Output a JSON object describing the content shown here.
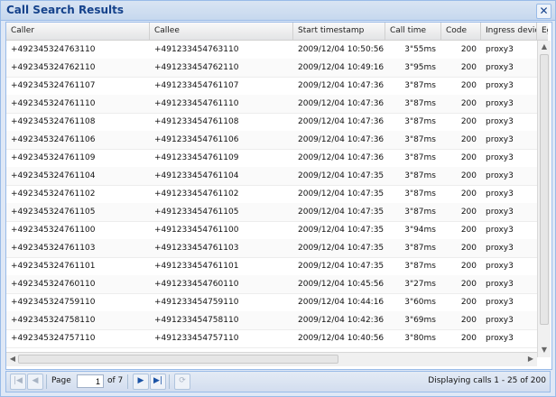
{
  "window": {
    "title": "Call Search Results",
    "close_glyph": "✕"
  },
  "columns": [
    "Caller",
    "Callee",
    "Start timestamp",
    "Call time",
    "Code",
    "Ingress device",
    "Eg"
  ],
  "rows": [
    [
      "+492345324763110",
      "+491233454763110",
      "2009/12/04 10:50:56",
      "3\"55ms",
      "200",
      "proxy3"
    ],
    [
      "+492345324762110",
      "+491233454762110",
      "2009/12/04 10:49:16",
      "3\"95ms",
      "200",
      "proxy3"
    ],
    [
      "+492345324761107",
      "+491233454761107",
      "2009/12/04 10:47:36",
      "3\"87ms",
      "200",
      "proxy3"
    ],
    [
      "+492345324761110",
      "+491233454761110",
      "2009/12/04 10:47:36",
      "3\"87ms",
      "200",
      "proxy3"
    ],
    [
      "+492345324761108",
      "+491233454761108",
      "2009/12/04 10:47:36",
      "3\"87ms",
      "200",
      "proxy3"
    ],
    [
      "+492345324761106",
      "+491233454761106",
      "2009/12/04 10:47:36",
      "3\"87ms",
      "200",
      "proxy3"
    ],
    [
      "+492345324761109",
      "+491233454761109",
      "2009/12/04 10:47:36",
      "3\"87ms",
      "200",
      "proxy3"
    ],
    [
      "+492345324761104",
      "+491233454761104",
      "2009/12/04 10:47:35",
      "3\"87ms",
      "200",
      "proxy3"
    ],
    [
      "+492345324761102",
      "+491233454761102",
      "2009/12/04 10:47:35",
      "3\"87ms",
      "200",
      "proxy3"
    ],
    [
      "+492345324761105",
      "+491233454761105",
      "2009/12/04 10:47:35",
      "3\"87ms",
      "200",
      "proxy3"
    ],
    [
      "+492345324761100",
      "+491233454761100",
      "2009/12/04 10:47:35",
      "3\"94ms",
      "200",
      "proxy3"
    ],
    [
      "+492345324761103",
      "+491233454761103",
      "2009/12/04 10:47:35",
      "3\"87ms",
      "200",
      "proxy3"
    ],
    [
      "+492345324761101",
      "+491233454761101",
      "2009/12/04 10:47:35",
      "3\"87ms",
      "200",
      "proxy3"
    ],
    [
      "+492345324760110",
      "+491233454760110",
      "2009/12/04 10:45:56",
      "3\"27ms",
      "200",
      "proxy3"
    ],
    [
      "+492345324759110",
      "+491233454759110",
      "2009/12/04 10:44:16",
      "3\"60ms",
      "200",
      "proxy3"
    ],
    [
      "+492345324758110",
      "+491233454758110",
      "2009/12/04 10:42:36",
      "3\"69ms",
      "200",
      "proxy3"
    ],
    [
      "+492345324757110",
      "+491233454757110",
      "2009/12/04 10:40:56",
      "3\"80ms",
      "200",
      "proxy3"
    ]
  ],
  "pager": {
    "page_label": "Page",
    "current_page": "1",
    "of_label": "of 7",
    "display_text": "Displaying calls 1 - 25 of 200"
  },
  "icons": {
    "first": "first-page-icon",
    "prev": "prev-page-icon",
    "next": "next-page-icon",
    "last": "last-page-icon",
    "refresh": "refresh-icon"
  }
}
